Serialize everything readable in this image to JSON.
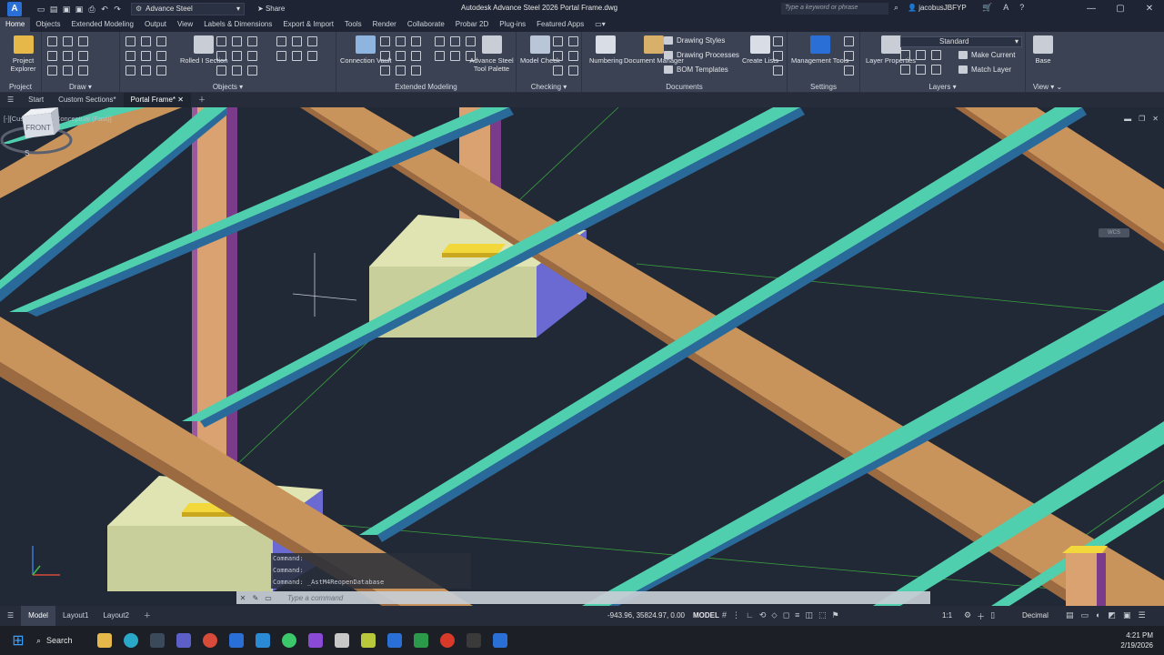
{
  "titlebar": {
    "app_letter": "A",
    "workspace": "Advance Steel",
    "share": "Share",
    "title": "Autodesk Advance Steel 2026   Portal Frame.dwg",
    "search_placeholder": "Type a keyword or phrase",
    "user": "jacobusJBFYP"
  },
  "tabs": [
    "Home",
    "Objects",
    "Extended Modeling",
    "Output",
    "View",
    "Labels & Dimensions",
    "Export & Import",
    "Tools",
    "Render",
    "Collaborate",
    "Probar 2D",
    "Plug-ins",
    "Featured Apps"
  ],
  "ribbon": {
    "project_explorer": "Project Explorer",
    "rolled_section": "Rolled I Section",
    "connection_vault": "Connection Vault",
    "tool_palette": "Advance Steel Tool Palette",
    "model_check": "Model Check",
    "numbering": "Numbering",
    "document_manager": "Document Manager",
    "drawing_styles": "Drawing Styles",
    "drawing_processes": "Drawing Processes",
    "bom_templates": "BOM Templates",
    "create_lists": "Create Lists",
    "management_tools": "Management Tools",
    "layer_properties": "Layer Properties",
    "layer_current": "Standard",
    "make_current": "Make Current",
    "match_layer": "Match Layer",
    "base": "Base",
    "panels": {
      "project": "Project",
      "draw": "Draw",
      "objects": "Objects",
      "extended_modeling": "Extended Modeling",
      "checking": "Checking",
      "documents": "Documents",
      "settings": "Settings",
      "layers": "Layers",
      "view": "View"
    }
  },
  "doctabs": {
    "start": "Start",
    "custom_sections": "Custom Sections*",
    "portal_frame": "Portal Frame*"
  },
  "viewport": {
    "label": "[-][Custom View][Conceptual (Fast)]",
    "viewcube_face": "FRONT",
    "viewcube_south": "S",
    "wcs": "WCS",
    "command_history": [
      "Command:",
      "Command:",
      "Command:  _AstM4ReopenDatabase"
    ],
    "command_placeholder": "Type a command"
  },
  "status": {
    "layouts": [
      "Model",
      "Layout1",
      "Layout2"
    ],
    "coords": "-943.96, 35824.97, 0.00",
    "model": "MODEL",
    "scale": "1:1",
    "units": "Decimal"
  },
  "taskbar": {
    "search": "Search",
    "time": "4:21 PM",
    "date": "2/19/2026"
  },
  "colors": {
    "rafter": "#c8945c",
    "purlin": "#4fcfae",
    "footing": "#c9cf9a",
    "column": "#7a3c8a",
    "baseplate": "#f2d83a",
    "background": "#212836"
  }
}
